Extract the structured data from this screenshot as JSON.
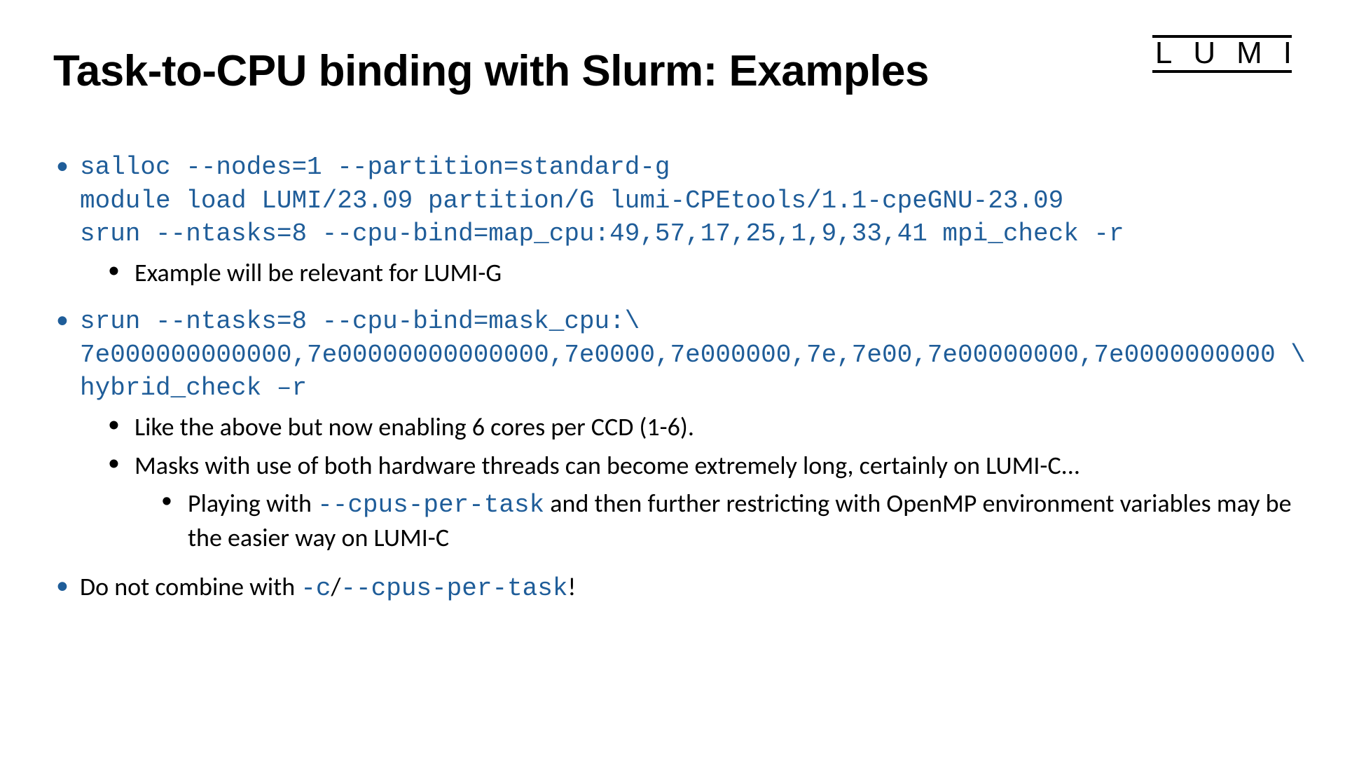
{
  "logo": "LUMI",
  "title": "Task-to-CPU binding with Slurm: Examples",
  "b1": {
    "code": "salloc --nodes=1 --partition=standard-g\nmodule load LUMI/23.09 partition/G lumi-CPEtools/1.1-cpeGNU-23.09\nsrun --ntasks=8 --cpu-bind=map_cpu:49,57,17,25,1,9,33,41 mpi_check -r",
    "sub1": "Example will be relevant for LUMI-G"
  },
  "b2": {
    "code": "srun --ntasks=8 --cpu-bind=mask_cpu:\\\n7e000000000000,7e00000000000000,7e0000,7e000000,7e,7e00,7e00000000,7e0000000000 \\\nhybrid_check –r",
    "sub1": "Like the above but now enabling 6 cores per CCD (1-6).",
    "sub2": "Masks with use of both hardware threads can become extremely long, certainly on LUMI-C...",
    "sub3_a": "Playing with ",
    "sub3_code": "--cpus-per-task",
    "sub3_b": " and then further restricting with OpenMP environment variables may be the easier way on LUMI-C"
  },
  "b3": {
    "t1": "Do not combine with ",
    "c1": "-c",
    "t2": "/",
    "c2": "--cpus-per-task",
    "t3": "!"
  }
}
